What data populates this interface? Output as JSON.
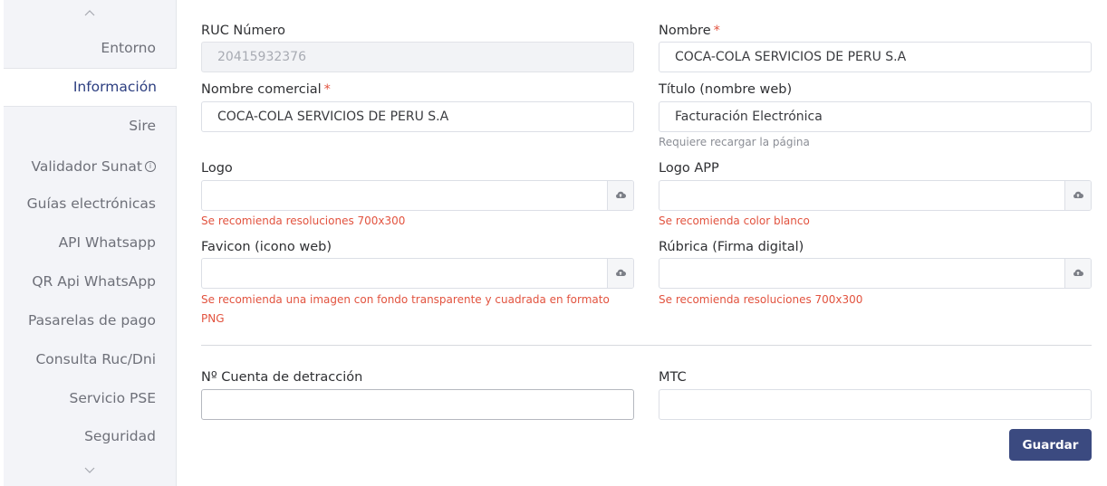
{
  "sidebar": {
    "items": [
      {
        "label": "Entorno"
      },
      {
        "label": "Información"
      },
      {
        "label": "Sire"
      },
      {
        "label": "Validador Sunat"
      },
      {
        "label": "Guías electrónicas"
      },
      {
        "label": "API Whatsapp"
      },
      {
        "label": "QR Api WhatsApp"
      },
      {
        "label": "Pasarelas de pago"
      },
      {
        "label": "Consulta Ruc/Dni"
      },
      {
        "label": "Servicio PSE"
      },
      {
        "label": "Seguridad"
      }
    ],
    "active": "Información"
  },
  "form": {
    "ruc": {
      "label": "RUC Número",
      "value": "20415932376"
    },
    "nombre": {
      "label": "Nombre",
      "required": "*",
      "value": "COCA-COLA SERVICIOS DE PERU S.A"
    },
    "nombre_comercial": {
      "label": "Nombre comercial",
      "required": "*",
      "value": "COCA-COLA SERVICIOS DE PERU S.A"
    },
    "titulo": {
      "label": "Título (nombre web)",
      "value": "Facturación Electrónica",
      "help": "Requiere recargar la página"
    },
    "logo": {
      "label": "Logo",
      "hint": "Se recomienda resoluciones 700x300"
    },
    "logo_app": {
      "label": "Logo APP",
      "hint": "Se recomienda color blanco"
    },
    "favicon": {
      "label": "Favicon (icono web)",
      "hint": "Se recomienda una imagen con fondo transparente y cuadrada en formato PNG"
    },
    "rubrica": {
      "label": "Rúbrica (Firma digital)",
      "hint": "Se recomienda resoluciones 700x300"
    },
    "cuenta_detraccion": {
      "label": "Nº Cuenta de detracción",
      "value": ""
    },
    "mtc": {
      "label": "MTC",
      "value": ""
    }
  },
  "actions": {
    "save_label": "Guardar"
  },
  "icons": {
    "upload": "cloud-upload-icon",
    "info": "info-icon",
    "up": "chevron-up-icon",
    "down": "chevron-down-icon"
  },
  "colors": {
    "accent": "#3b4a80",
    "active_text": "#2c3e80",
    "hint": "#e2533f",
    "sidebar_bg": "#f3f4f8"
  }
}
